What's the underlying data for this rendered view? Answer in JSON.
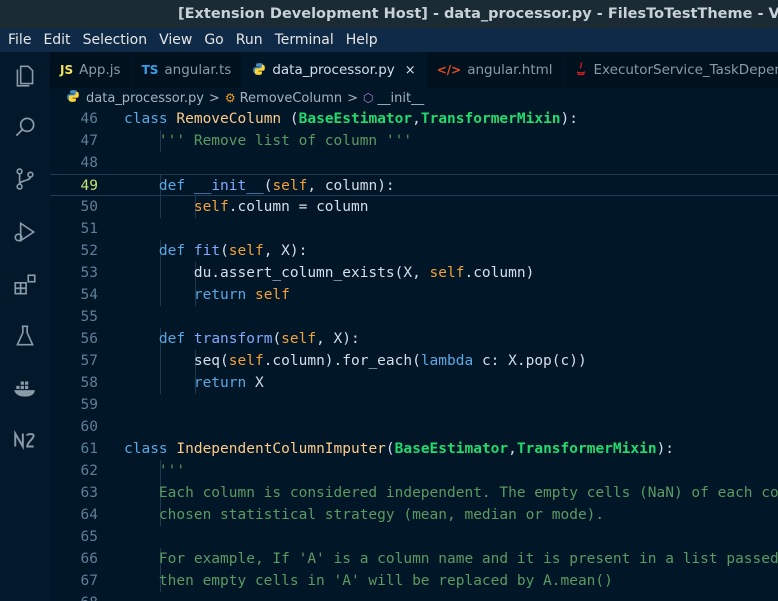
{
  "window": {
    "title": "[Extension Development Host] - data_processor.py - FilesToTestTheme - Visual Studio Code"
  },
  "menu": [
    "File",
    "Edit",
    "Selection",
    "View",
    "Go",
    "Run",
    "Terminal",
    "Help"
  ],
  "activity_bar": [
    {
      "name": "files-icon"
    },
    {
      "name": "search-icon"
    },
    {
      "name": "source-control-icon"
    },
    {
      "name": "run-debug-icon"
    },
    {
      "name": "extensions-icon"
    },
    {
      "name": "testing-icon"
    },
    {
      "name": "docker-icon"
    },
    {
      "name": "nx-icon"
    }
  ],
  "tabs": [
    {
      "icon": "JS",
      "icon_color": "#f1e05a",
      "label": "App.js",
      "active": false
    },
    {
      "icon": "TS",
      "icon_color": "#3a9ee6",
      "label": "angular.ts",
      "active": false
    },
    {
      "icon": "py",
      "icon_color": "#4b8bbe",
      "label": "data_processor.py",
      "active": true,
      "close": "×"
    },
    {
      "icon": "</>",
      "icon_color": "#e44d26",
      "label": "angular.html",
      "active": false
    },
    {
      "icon": "java",
      "icon_color": "#e11d21",
      "label": "ExecutorService_TaskDependency.java",
      "active": false
    }
  ],
  "breadcrumb": {
    "file": "data_processor.py",
    "class": "RemoveColumn",
    "method": "__init__",
    "separator": ">"
  },
  "editor": {
    "current_line": 49,
    "lines": [
      {
        "n": "46",
        "code": "class RemoveColumn (BaseEstimator,TransformerMixin):"
      },
      {
        "n": "47",
        "code": "    ''' Remove list of column '''"
      },
      {
        "n": "48",
        "code": ""
      },
      {
        "n": "49",
        "code": "    def __init__(self, column):"
      },
      {
        "n": "50",
        "code": "        self.column = column"
      },
      {
        "n": "51",
        "code": ""
      },
      {
        "n": "52",
        "code": "    def fit(self, X):"
      },
      {
        "n": "53",
        "code": "        du.assert_column_exists(X, self.column)"
      },
      {
        "n": "54",
        "code": "        return self"
      },
      {
        "n": "55",
        "code": ""
      },
      {
        "n": "56",
        "code": "    def transform(self, X):"
      },
      {
        "n": "57",
        "code": "        seq(self.column).for_each(lambda c: X.pop(c))"
      },
      {
        "n": "58",
        "code": "        return X"
      },
      {
        "n": "59",
        "code": ""
      },
      {
        "n": "60",
        "code": ""
      },
      {
        "n": "61",
        "code": "class IndependentColumnImputer(BaseEstimator,TransformerMixin):"
      },
      {
        "n": "62",
        "code": "    '''"
      },
      {
        "n": "63",
        "code": "    Each column is considered independent. The empty cells (NaN) of each column"
      },
      {
        "n": "64",
        "code": "    chosen statistical strategy (mean, median or mode)."
      },
      {
        "n": "65",
        "code": ""
      },
      {
        "n": "66",
        "code": "    For example, If 'A' is a column name and it is present in a list passed"
      },
      {
        "n": "67",
        "code": "    then empty cells in 'A' will be replaced by A.mean()"
      },
      {
        "n": "68",
        "code": ""
      }
    ]
  },
  "colors": {
    "background": "#011627",
    "keyword": "#5ca7e4",
    "class_name": "#ffcb8b",
    "base_class": "#22da6e",
    "self": "#f2a23b",
    "comment": "#5b9a62"
  }
}
